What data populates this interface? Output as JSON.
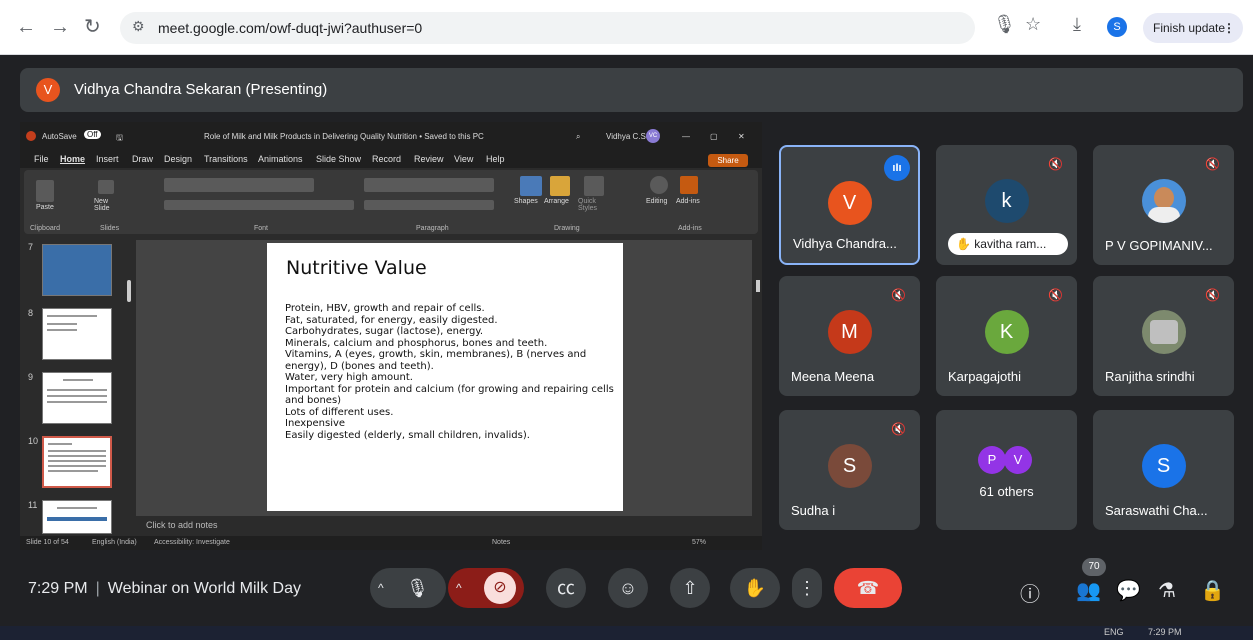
{
  "browser": {
    "url": "meet.google.com/owf-duqt-jwi?authuser=0",
    "profile_initial": "S",
    "finish_update_label": "Finish update"
  },
  "presenter": {
    "initial": "V",
    "label": "Vidhya Chandra Sekaran (Presenting)"
  },
  "ppt": {
    "autosave": "AutoSave",
    "autosave_state": "Off",
    "doc_title": "Role of Milk and Milk Products in Delivering Quality Nutrition • Saved to this PC",
    "user": "Vidhya C.S.",
    "user_initials": "VC",
    "share_label": "Share",
    "menu": [
      "File",
      "Home",
      "Insert",
      "Draw",
      "Design",
      "Transitions",
      "Animations",
      "Slide Show",
      "Record",
      "Review",
      "View",
      "Help"
    ],
    "ribbon_groups": [
      "Clipboard",
      "Slides",
      "Font",
      "Paragraph",
      "Drawing",
      "Add-ins"
    ],
    "ribbon_labels": {
      "paste": "Paste",
      "new_slide": "New Slide",
      "shapes": "Shapes",
      "arrange": "Arrange",
      "quick_styles": "Quick Styles",
      "editing": "Editing",
      "addins": "Add-ins"
    },
    "thumb_numbers": [
      "7",
      "8",
      "9",
      "10",
      "11"
    ],
    "slide": {
      "title": "Nutritive Value",
      "lines": [
        "Protein, HBV, growth and repair of cells.",
        "Fat, saturated, for energy, easily digested.",
        "Carbohydrates, sugar (lactose), energy.",
        "Minerals, calcium and phosphorus, bones and teeth.",
        "Vitamins, A (eyes, growth, skin, membranes), B (nerves and energy), D (bones and teeth).",
        "Water, very high amount.",
        "Important for protein and calcium (for growing and repairing cells and bones)",
        "Lots of different uses.",
        "Inexpensive",
        "Easily digested (elderly, small children, invalids)."
      ]
    },
    "notes_placeholder": "Click to add notes",
    "status": {
      "slide_of": "Slide 10 of 54",
      "language": "English (India)",
      "accessibility": "Accessibility: Investigate",
      "notes": "Notes",
      "zoom": "57%"
    }
  },
  "participants": [
    {
      "name": "Vidhya Chandra...",
      "initial": "V",
      "color": "#e8541e",
      "speaking": true
    },
    {
      "name": "kavitha ram...",
      "initial": "k",
      "color": "#1e4a6e",
      "pill": true
    },
    {
      "name": "P V GOPIMANIV...",
      "initial": "",
      "color": "#4a90d9",
      "photo": true
    },
    {
      "name": "Meena Meena",
      "initial": "M",
      "color": "#c5391a"
    },
    {
      "name": "Karpagajothi",
      "initial": "K",
      "color": "#6aa83d"
    },
    {
      "name": "Ranjitha srindhi",
      "initial": "",
      "color": "#8a8a8a",
      "photo": true
    },
    {
      "name": "Sudha i",
      "initial": "S",
      "color": "#7a4a3a"
    },
    {
      "name": "61 others",
      "initials": [
        "P",
        "V"
      ],
      "colors": [
        "#9334e6",
        "#9334e6"
      ]
    },
    {
      "name": "Saraswathi Cha...",
      "initial": "S",
      "color": "#1a73e8"
    }
  ],
  "bottom": {
    "time": "7:29 PM",
    "meeting_title": "Webinar on World Milk Day",
    "people_count": "70"
  },
  "taskbar": {
    "lang": "ENG",
    "time": "7:29 PM"
  }
}
